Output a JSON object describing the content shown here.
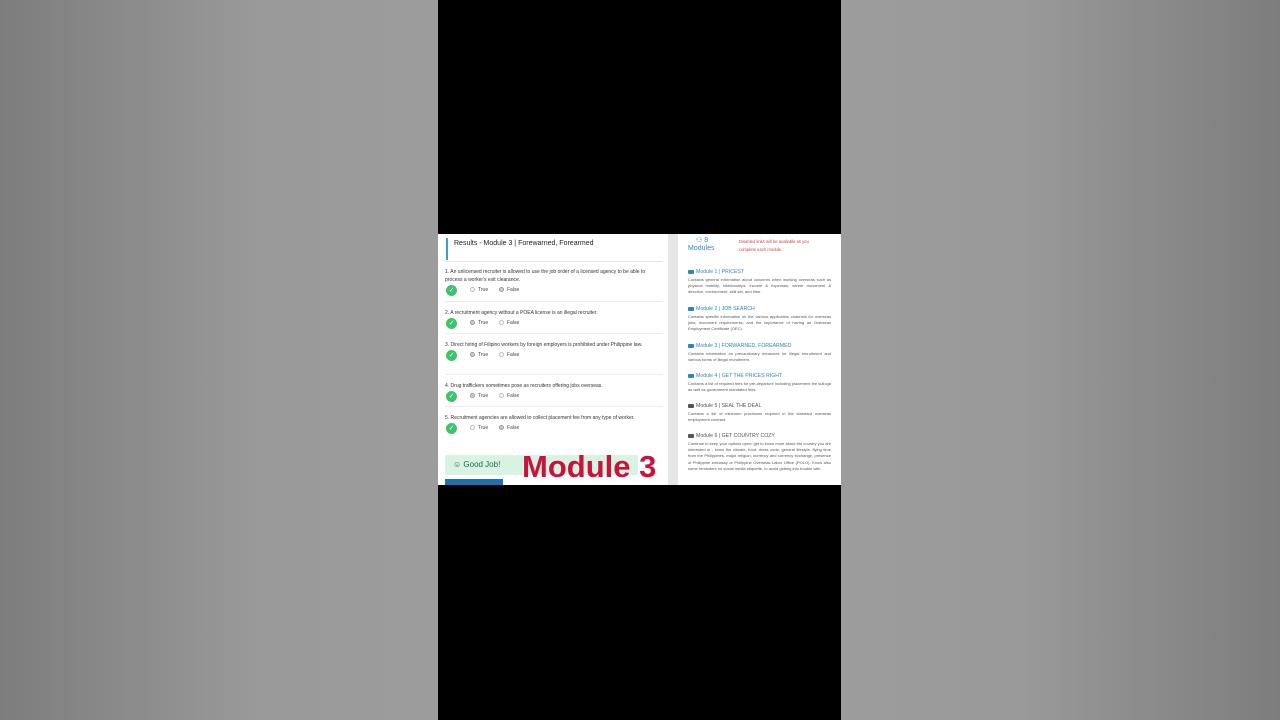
{
  "results": {
    "title": "Results - Module 3 | Forewarned, Forearmed",
    "options": [
      "True",
      "False"
    ],
    "questions": [
      {
        "text": "1. An unlicensed recruiter is allowed to use the job order of a licensed agency to be able to process a worker's exit clearance.",
        "selected": "False"
      },
      {
        "text": "2. A recruitment agency without a POEA license is an illegal recruiter.",
        "selected": "True"
      },
      {
        "text": "3. Direct hiring of Filipino workers by foreign employers is prohibited under Philippine law.",
        "selected": "True"
      },
      {
        "text": "4. Drug traffickers sometimes pose as recruiters offering jobs overseas.",
        "selected": "True"
      },
      {
        "text": "5. Recruitment agencies are allowed to collect placement fee from any type of worker.",
        "selected": "False"
      }
    ],
    "good_job": "Good Job!",
    "overlay_caption": "Module 3"
  },
  "modules_panel": {
    "count_label": "8",
    "heading": "Modules",
    "note": "Disabled links will be available as you complete each module.",
    "modules": [
      {
        "title": "Module 1 | PRICEST",
        "desc": "Contains general information about concerns when working overseas such as physical mobility, relationships, income & expenses, career movement & direction, environment, skill set, and time.",
        "enabled": true
      },
      {
        "title": "Module 2 | JOB SEARCH",
        "desc": "Contains specific information on the various application channels for overseas jobs, document requirements, and the importance of having an Overseas Employment Certificate (OEC).",
        "enabled": true
      },
      {
        "title": "Module 3 | FORWARNED, FOREARMED",
        "desc": "Contains information on precautionary measures for illegal recruitment and various forms of illegal recruitment.",
        "enabled": true
      },
      {
        "title": "Module 4 | GET THE PRICES RIGHT",
        "desc": "Contains a list of required fees for pre-departure including placement fee sulloga as well as government mandated fees.",
        "enabled": true
      },
      {
        "title": "Module 5 | SEAL THE DEAL",
        "desc": "Contains a list of minimum provisions required in the standard overseas employment contract.",
        "enabled": false
      },
      {
        "title": "Module 6 | GET COUNTRY COZY",
        "desc": "Continue to keep your options open: get to know more about the country you are interested in - know the climate, food, dress code, general lifestyle, flying time from the Philippines, major religion, currency and currency exchange, presence of Philippine embassy or Philippine Overseas Labor Office (POLO). Know also some reminders on social media etiquette, to avoid getting into trouble with",
        "enabled": false
      }
    ]
  },
  "colors": {
    "accent": "#2e86b8",
    "check": "#3cc36e",
    "overlay": "#c8143c",
    "note": "#d04040"
  }
}
